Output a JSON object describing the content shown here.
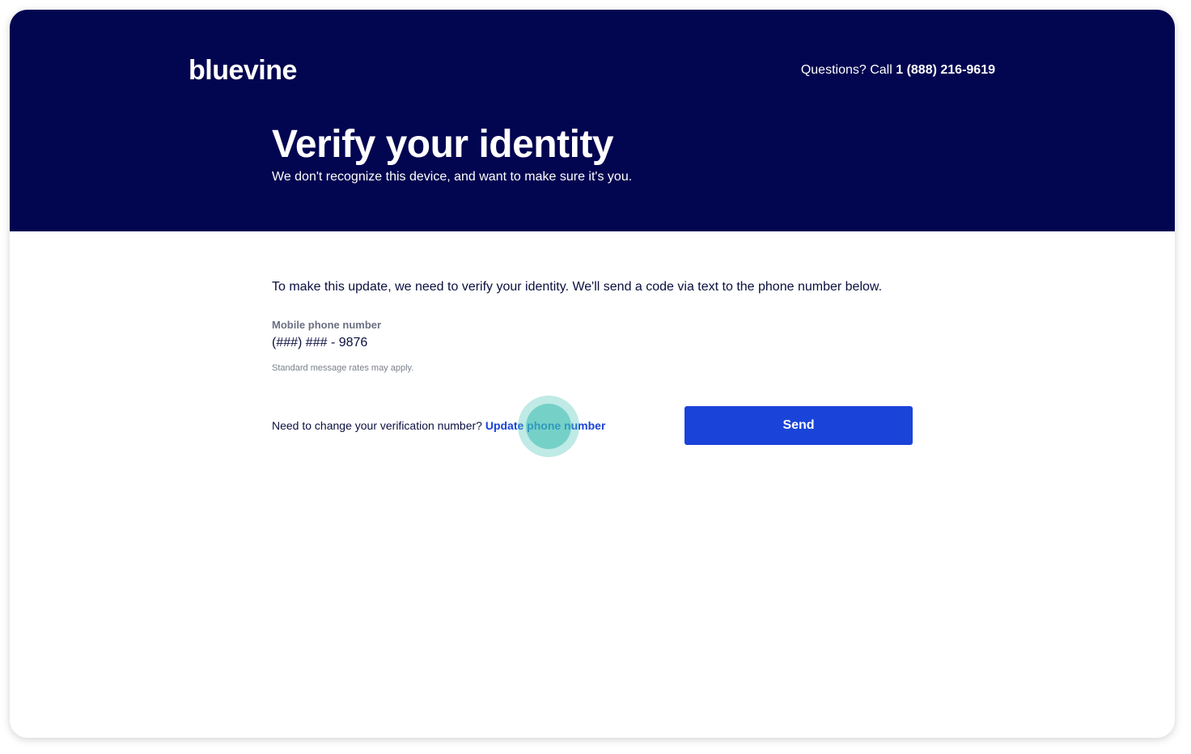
{
  "header": {
    "logo_text": "bluevine",
    "contact_prefix": "Questions? Call",
    "contact_phone": "1 (888) 216-9619",
    "title": "Verify your identity",
    "subtitle": "We don't recognize this device, and want to make sure it's you."
  },
  "main": {
    "intro": "To make this update, we need to verify your identity. We'll send a code via text to the phone number below.",
    "phone_label": "Mobile phone number",
    "phone_value": "(###) ### - 9876",
    "rates_note": "Standard message rates may apply.",
    "change_prompt": "Need to change your verification number?",
    "update_link": "Update phone number",
    "send_label": "Send"
  },
  "colors": {
    "hero_bg": "#020550",
    "primary": "#1a44d9",
    "text": "#0b0f3f"
  }
}
